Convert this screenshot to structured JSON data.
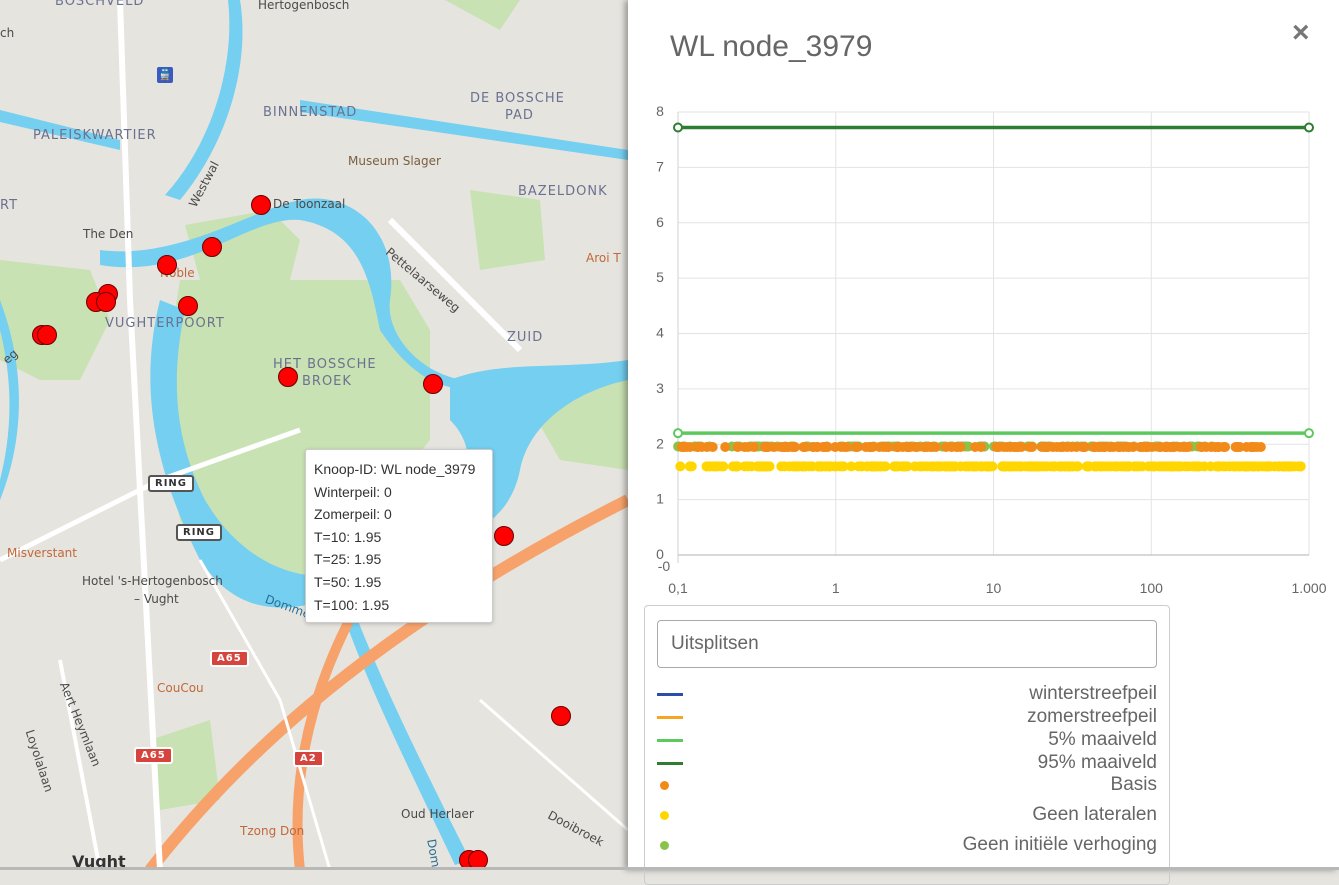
{
  "map": {
    "labels": [
      {
        "text": "BOSCHVELD",
        "cls": ""
      },
      {
        "text": "Hertogenbosch",
        "cls": "plain"
      },
      {
        "text": "BINNENSTAD",
        "cls": ""
      },
      {
        "text": "DE BOSSCHE",
        "cls": ""
      },
      {
        "text": "PAD",
        "cls": ""
      },
      {
        "text": "PALEISKWARTIER",
        "cls": ""
      },
      {
        "text": "Museum Slager",
        "cls": "poi"
      },
      {
        "text": "BAZELDONK",
        "cls": ""
      },
      {
        "text": "De Toonzaal",
        "cls": "plain"
      },
      {
        "text": "The Den",
        "cls": "plain"
      },
      {
        "text": "Pettelaarseweg",
        "cls": "plain"
      },
      {
        "text": "Aroi T",
        "cls": "orange"
      },
      {
        "text": "VUGHTERPOORT",
        "cls": ""
      },
      {
        "text": "ZUID",
        "cls": ""
      },
      {
        "text": "HET BOSSCHE",
        "cls": ""
      },
      {
        "text": "BROEK",
        "cls": ""
      },
      {
        "text": "Misverstant",
        "cls": "orange"
      },
      {
        "text": "Hotel 's-Hertogenbosch",
        "cls": "plain"
      },
      {
        "text": "– Vught",
        "cls": "plain"
      },
      {
        "text": "CouCou",
        "cls": "orange"
      },
      {
        "text": "Tzong Don",
        "cls": "orange"
      },
      {
        "text": "Oud Herlaer",
        "cls": "plain"
      },
      {
        "text": "Dooibroek",
        "cls": "plain"
      },
      {
        "text": "Vught",
        "cls": "plain"
      },
      {
        "text": "Westwal",
        "cls": "plain"
      },
      {
        "text": "Aert Heymlaan",
        "cls": "plain"
      },
      {
        "text": "Loyolalaan",
        "cls": "plain"
      },
      {
        "text": "RT",
        "cls": ""
      },
      {
        "text": "ch",
        "cls": "plain"
      },
      {
        "text": "Noble",
        "cls": "orange"
      },
      {
        "text": "eg",
        "cls": "plain"
      },
      {
        "text": "Dommel",
        "cls": "plain"
      },
      {
        "text": "Dom",
        "cls": "plain"
      }
    ],
    "shields": [
      "RING",
      "RING",
      "A65",
      "A65",
      "A2",
      "A2"
    ]
  },
  "tooltip": {
    "lines": [
      "Knoop-ID: WL node_3979",
      "Winterpeil: 0",
      "Zomerpeil: 0",
      "T=10: 1.95",
      "T=25: 1.95",
      "T=50: 1.95",
      "T=100: 1.95"
    ]
  },
  "panel": {
    "title": "WL node_3979",
    "close_icon": "×",
    "split_placeholder": "Uitsplitsen",
    "legend": [
      {
        "label": "winterstreefpeil",
        "kind": "line",
        "color": "#2b4ea8"
      },
      {
        "label": "zomerstreefpeil",
        "kind": "line",
        "color": "#f5a623"
      },
      {
        "label": "5% maaiveld",
        "kind": "line",
        "color": "#5dc95d"
      },
      {
        "label": "95% maaiveld",
        "kind": "line",
        "color": "#2e7d32"
      },
      {
        "label": "Basis",
        "kind": "dot",
        "color": "#f28a1a"
      },
      {
        "label": "Geen lateralen",
        "kind": "dot",
        "color": "#ffd600"
      },
      {
        "label": "Geen initiële verhoging",
        "kind": "dot",
        "color": "#8bc34a"
      }
    ]
  },
  "chart_data": {
    "type": "scatter",
    "xscale": "log",
    "xlim": [
      0.1,
      1000
    ],
    "ylim": [
      -0.2,
      8
    ],
    "xticks": [
      "0,1",
      "1",
      "10",
      "100",
      "1.000"
    ],
    "yticks": [
      "-0",
      "0",
      "1",
      "2",
      "3",
      "4",
      "5",
      "6",
      "7",
      "8"
    ],
    "series": [
      {
        "name": "95% maaiveld",
        "kind": "line",
        "color": "#2e7d32",
        "x": [
          0.1,
          1000
        ],
        "y": [
          7.72,
          7.72
        ]
      },
      {
        "name": "5% maaiveld",
        "kind": "line",
        "color": "#5dc95d",
        "x": [
          0.1,
          1000
        ],
        "y": [
          2.2,
          2.2
        ]
      },
      {
        "name": "Basis",
        "kind": "scatter",
        "color": "#f28a1a",
        "y": 1.95,
        "xrange": [
          0.1,
          500
        ]
      },
      {
        "name": "Geen initiële verhoging",
        "kind": "scatter",
        "color": "#8bc34a",
        "y": 1.96,
        "xrange": [
          0.1,
          250
        ]
      },
      {
        "name": "Geen lateralen",
        "kind": "scatter",
        "color": "#ffd600",
        "y": 1.6,
        "xrange": [
          0.1,
          950
        ]
      }
    ]
  }
}
